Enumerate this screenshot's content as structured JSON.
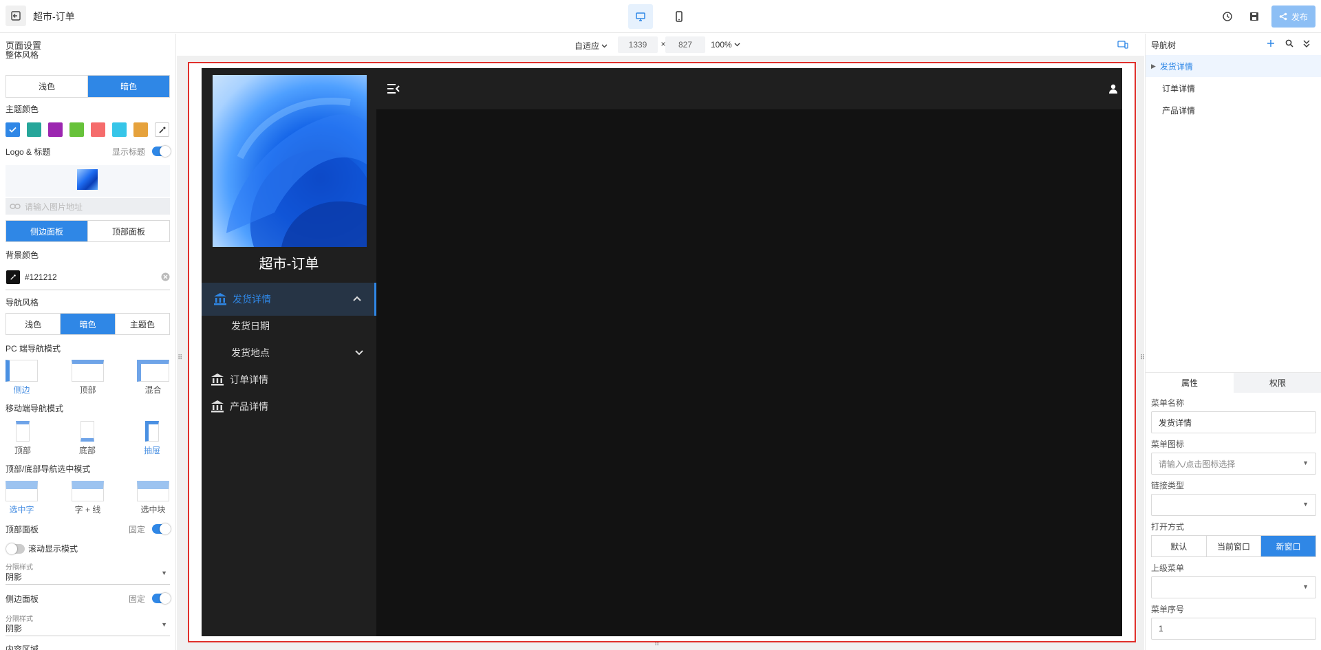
{
  "app": {
    "title": "超市-订单",
    "publish_label": "发布"
  },
  "left": {
    "page_settings": "页面设置",
    "overall_style": "整体风格",
    "style_options": [
      "浅色",
      "暗色"
    ],
    "theme_color_label": "主题颜色",
    "theme_colors": [
      "#2f87e6",
      "#26a69a",
      "#9c27b0",
      "#67c23a",
      "#f56c6c",
      "#36c5e8",
      "#e6a23c"
    ],
    "logo_title_label": "Logo & 标题",
    "show_title_label": "显示标题",
    "image_placeholder": "请输入图片地址",
    "panel_options": [
      "侧边面板",
      "顶部面板"
    ],
    "bg_color_label": "背景颜色",
    "bg_color_value": "#121212",
    "nav_style_label": "导航风格",
    "nav_style_options": [
      "浅色",
      "暗色",
      "主题色"
    ],
    "pc_nav_mode_label": "PC 端导航模式",
    "pc_nav_modes": [
      "侧边",
      "顶部",
      "混合"
    ],
    "mobile_nav_mode_label": "移动端导航模式",
    "mobile_nav_modes": [
      "顶部",
      "底部",
      "抽屉"
    ],
    "select_mode_label": "顶部/底部导航选中模式",
    "select_modes": [
      "选中字",
      "字 + 线",
      "选中块"
    ],
    "top_panel_label": "顶部面板",
    "fixed_label": "固定",
    "scroll_mode_label": "滚动显示模式",
    "sep_style_label": "分隔样式",
    "sep_style_value": "阴影",
    "side_panel_label": "侧边面板",
    "content_area_label": "内容区域"
  },
  "canvas": {
    "fit_label": "自适应",
    "width": "1339",
    "times": "×",
    "height": "827",
    "zoom": "100%",
    "preview": {
      "title": "超市-订单",
      "nav": [
        {
          "label": "发货详情",
          "active": true
        },
        {
          "label": "发货日期"
        },
        {
          "label": "发货地点"
        },
        {
          "label": "订单详情"
        },
        {
          "label": "产品详情"
        }
      ]
    }
  },
  "right": {
    "nav_tree_label": "导航树",
    "tree": [
      "发货详情",
      "订单详情",
      "产品详情"
    ],
    "tabs": [
      "属性",
      "权限"
    ],
    "menu_name_label": "菜单名称",
    "menu_name_value": "发货详情",
    "menu_icon_label": "菜单图标",
    "menu_icon_placeholder": "请输入/点击图标选择",
    "link_type_label": "链接类型",
    "open_mode_label": "打开方式",
    "open_modes": [
      "默认",
      "当前窗口",
      "新窗口"
    ],
    "parent_menu_label": "上级菜单",
    "menu_order_label": "菜单序号",
    "menu_order_value": "1"
  }
}
